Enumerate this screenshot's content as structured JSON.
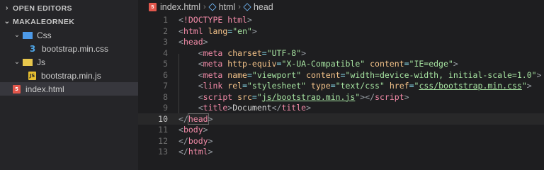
{
  "sidebar": {
    "open_editors_label": "OPEN EDITORS",
    "project_label": "MAKALEORNEK",
    "tree": [
      {
        "label": "Css",
        "kind": "folder-css",
        "depth": 1,
        "chevron": "⌄"
      },
      {
        "label": "bootstrap.min.css",
        "kind": "file-css",
        "depth": 2,
        "icon_text": "3"
      },
      {
        "label": "Js",
        "kind": "folder-js",
        "depth": 1,
        "chevron": "⌄"
      },
      {
        "label": "bootstrap.min.js",
        "kind": "file-js",
        "depth": 2,
        "icon_text": "JS"
      },
      {
        "label": "index.html",
        "kind": "file-html",
        "depth": 1,
        "icon_text": "5",
        "selected": true
      }
    ]
  },
  "breadcrumb": {
    "file": "index.html",
    "icon_text": "5",
    "items": [
      "html",
      "head"
    ]
  },
  "editor": {
    "active_line": 10,
    "lines": [
      {
        "n": "1",
        "tokens": [
          [
            "punc",
            "<"
          ],
          [
            "doctype",
            "!DOCTYPE"
          ],
          [
            "txt",
            " "
          ],
          [
            "tag",
            "html"
          ],
          [
            "punc",
            ">"
          ]
        ]
      },
      {
        "n": "2",
        "tokens": [
          [
            "punc",
            "<"
          ],
          [
            "tag",
            "html"
          ],
          [
            "txt",
            " "
          ],
          [
            "attr",
            "lang"
          ],
          [
            "eq",
            "="
          ],
          [
            "str",
            "\"en\""
          ],
          [
            "punc",
            ">"
          ]
        ]
      },
      {
        "n": "3",
        "tokens": [
          [
            "punc",
            "<"
          ],
          [
            "tag",
            "head"
          ],
          [
            "punc",
            ">"
          ]
        ]
      },
      {
        "n": "4",
        "tokens": [
          [
            "txt",
            "    "
          ],
          [
            "punc",
            "<"
          ],
          [
            "tag",
            "meta"
          ],
          [
            "txt",
            " "
          ],
          [
            "attr",
            "charset"
          ],
          [
            "eq",
            "="
          ],
          [
            "str",
            "\"UTF-8\""
          ],
          [
            "punc",
            ">"
          ]
        ]
      },
      {
        "n": "5",
        "tokens": [
          [
            "txt",
            "    "
          ],
          [
            "punc",
            "<"
          ],
          [
            "tag",
            "meta"
          ],
          [
            "txt",
            " "
          ],
          [
            "attr",
            "http-equiv"
          ],
          [
            "eq",
            "="
          ],
          [
            "str",
            "\"X-UA-Compatible\""
          ],
          [
            "txt",
            " "
          ],
          [
            "attr",
            "content"
          ],
          [
            "eq",
            "="
          ],
          [
            "str",
            "\"IE=edge\""
          ],
          [
            "punc",
            ">"
          ]
        ]
      },
      {
        "n": "6",
        "tokens": [
          [
            "txt",
            "    "
          ],
          [
            "punc",
            "<"
          ],
          [
            "tag",
            "meta"
          ],
          [
            "txt",
            " "
          ],
          [
            "attr",
            "name"
          ],
          [
            "eq",
            "="
          ],
          [
            "str",
            "\"viewport\""
          ],
          [
            "txt",
            " "
          ],
          [
            "attr",
            "content"
          ],
          [
            "eq",
            "="
          ],
          [
            "str",
            "\"width=device-width, initial-scale=1.0\""
          ],
          [
            "punc",
            ">"
          ]
        ]
      },
      {
        "n": "7",
        "tokens": [
          [
            "txt",
            "    "
          ],
          [
            "punc",
            "<"
          ],
          [
            "tag",
            "link"
          ],
          [
            "txt",
            " "
          ],
          [
            "attr",
            "rel"
          ],
          [
            "eq",
            "="
          ],
          [
            "str",
            "\"stylesheet\""
          ],
          [
            "txt",
            " "
          ],
          [
            "attr",
            "type"
          ],
          [
            "eq",
            "="
          ],
          [
            "str",
            "\"text/css\""
          ],
          [
            "txt",
            " "
          ],
          [
            "attr",
            "href"
          ],
          [
            "eq",
            "="
          ],
          [
            "str",
            "\""
          ],
          [
            "lnk",
            "css/bootstrap.min.css"
          ],
          [
            "str",
            "\""
          ],
          [
            "punc",
            ">"
          ]
        ]
      },
      {
        "n": "8",
        "tokens": [
          [
            "txt",
            "    "
          ],
          [
            "punc",
            "<"
          ],
          [
            "tag",
            "script"
          ],
          [
            "txt",
            " "
          ],
          [
            "attr",
            "src"
          ],
          [
            "eq",
            "="
          ],
          [
            "str",
            "\""
          ],
          [
            "lnk",
            "js/bootstrap.min.js"
          ],
          [
            "str",
            "\""
          ],
          [
            "punc",
            "></"
          ],
          [
            "tag",
            "script"
          ],
          [
            "punc",
            ">"
          ]
        ]
      },
      {
        "n": "9",
        "tokens": [
          [
            "txt",
            "    "
          ],
          [
            "punc",
            "<"
          ],
          [
            "tag",
            "title"
          ],
          [
            "punc",
            ">"
          ],
          [
            "txt",
            "Document"
          ],
          [
            "punc",
            "</"
          ],
          [
            "tag",
            "title"
          ],
          [
            "punc",
            ">"
          ]
        ]
      },
      {
        "n": "10",
        "tokens": [
          [
            "punc",
            "</"
          ],
          [
            "taghl",
            "head"
          ],
          [
            "punc",
            ">"
          ]
        ]
      },
      {
        "n": "11",
        "tokens": [
          [
            "punc",
            "<"
          ],
          [
            "tag",
            "body"
          ],
          [
            "punc",
            ">"
          ]
        ]
      },
      {
        "n": "12",
        "tokens": [
          [
            "punc",
            "</"
          ],
          [
            "tag",
            "body"
          ],
          [
            "punc",
            ">"
          ]
        ]
      },
      {
        "n": "13",
        "tokens": [
          [
            "punc",
            "</"
          ],
          [
            "tag",
            "html"
          ],
          [
            "punc",
            ">"
          ]
        ]
      }
    ]
  },
  "colors": {
    "background": "#1e1e20",
    "sidebar": "#252528",
    "tag": "#f38ba8",
    "attribute": "#f5c48a",
    "string": "#a6e3a1"
  }
}
